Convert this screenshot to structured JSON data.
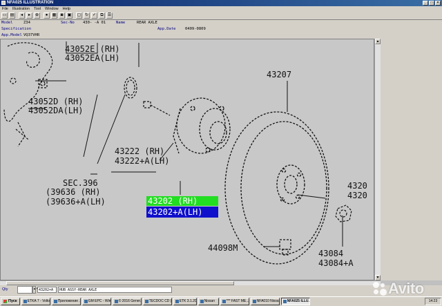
{
  "window": {
    "title": "NFA025 ILLUSTRATION",
    "buttons": [
      "_",
      "□",
      "×"
    ]
  },
  "menu": [
    "File",
    "Illustration",
    "Tool",
    "Window",
    "Help"
  ],
  "toolbar_icons": [
    "save-icon",
    "print-icon",
    "back-icon",
    "forward-icon",
    "zoom-icon",
    "stop-icon",
    "grid-icon",
    "camera-icon",
    "mark-icon",
    "window-icon",
    "sync-icon",
    "check-icon",
    "copy-icon",
    "arrange-icon"
  ],
  "info": {
    "model_label": "Model",
    "model_value": "Z34",
    "secno_label": "Sec-No",
    "secno_value": "430-  -A 01",
    "name_label": "Name",
    "name_value": "REAR AXLE",
    "spec_label": "Specification",
    "appdate_label": "App.Date",
    "appdate_value": "0409-0809",
    "appmodel_label": "App.Model",
    "appmodel_value": "VQ37VHR"
  },
  "diagram": {
    "labels": {
      "p43052e": "43052E (RH)",
      "p43052ea": "43052EA(LH)",
      "p43052d": "43052D (RH)",
      "p43052da": "43052DA(LH)",
      "p43207": "43207",
      "p43222": "43222  (RH)",
      "p43222a": "43222+A(LH)",
      "sec396": "SEC.396",
      "p39636": "(39636  (RH)",
      "p39636a": "(39636+A(LH)",
      "p43202": "43202  (RH)",
      "p43202a": "43202+A(LH)",
      "p44098m": "44098M",
      "p43084": "43084",
      "p43084a": "43084+A",
      "p4320r": "4320",
      "p4320ra": "4320"
    },
    "highlight_colors": {
      "rh": "#22dd22",
      "lh": "#1010cc"
    }
  },
  "bottom": {
    "qty_label": "Qty",
    "part_no": "43202+A",
    "description": "HUB ASSY-REAR AXLE"
  },
  "taskbar": {
    "start_label": "Пуск",
    "tasks": [
      "ETKA 7 - Volks...",
      "Приложение ...",
      "GM EPC - Wind...",
      "© 2016 Gener...",
      "TECDOC CD (3...",
      "ETK 3.1.20",
      "Nissan",
      "*** FAST ME...",
      "NFA010 Nissa...",
      "NFA025 ILLU..."
    ],
    "clock": "14:23"
  },
  "watermark": "Avito"
}
